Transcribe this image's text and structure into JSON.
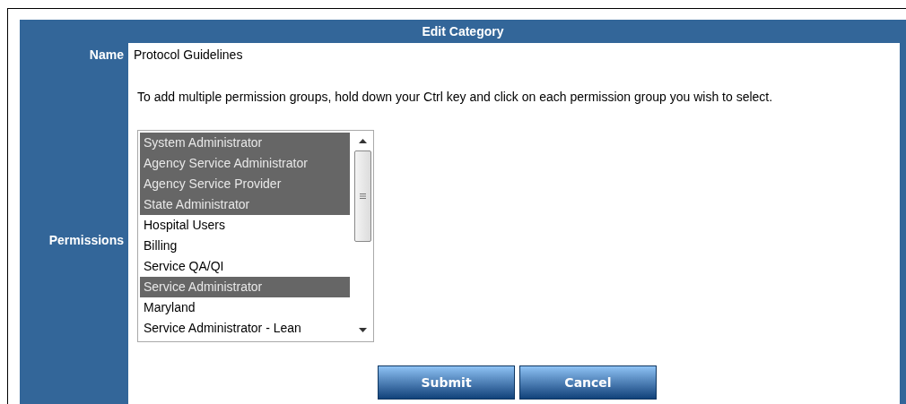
{
  "form": {
    "title": "Edit Category",
    "name_label": "Name",
    "name_value": "Protocol Guidelines",
    "permissions_label": "Permissions",
    "instructions": "To add multiple permission groups, hold down your Ctrl key and click on each permission group you wish to select.",
    "permission_groups": [
      {
        "label": "System Administrator",
        "selected": true
      },
      {
        "label": "Agency Service Administrator",
        "selected": true
      },
      {
        "label": "Agency Service Provider",
        "selected": true
      },
      {
        "label": "State Administrator",
        "selected": true
      },
      {
        "label": "Hospital Users",
        "selected": false
      },
      {
        "label": "Billing",
        "selected": false
      },
      {
        "label": "Service QA/QI",
        "selected": false
      },
      {
        "label": "Service Administrator",
        "selected": true
      },
      {
        "label": "Maryland",
        "selected": false
      },
      {
        "label": "Service Administrator - Lean",
        "selected": false
      }
    ],
    "buttons": [
      "Submit",
      "Cancel"
    ]
  }
}
